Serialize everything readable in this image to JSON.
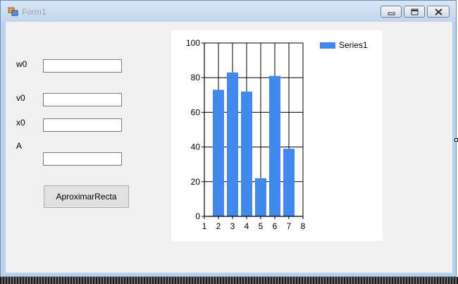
{
  "window": {
    "title": "Form1"
  },
  "form": {
    "labels": {
      "w0": "w0",
      "v0": "v0",
      "x0": "x0",
      "A": "A"
    },
    "fields": {
      "w0": "",
      "v0": "",
      "x0": "",
      "A": ""
    },
    "button_label": "AproximarRecta"
  },
  "chart_data": {
    "type": "bar",
    "x": [
      2,
      3,
      4,
      5,
      6,
      7
    ],
    "values": [
      73,
      83,
      72,
      22,
      81,
      39
    ],
    "xlim": [
      1,
      8
    ],
    "ylim": [
      0,
      100
    ],
    "xticks": [
      "1",
      "2",
      "3",
      "4",
      "5",
      "6",
      "7",
      "8"
    ],
    "yticks": [
      "0",
      "20",
      "40",
      "60",
      "80",
      "100"
    ],
    "grid": true,
    "series": [
      {
        "name": "Series1",
        "color": "#4189ec"
      }
    ],
    "legend_position": "top-right"
  }
}
